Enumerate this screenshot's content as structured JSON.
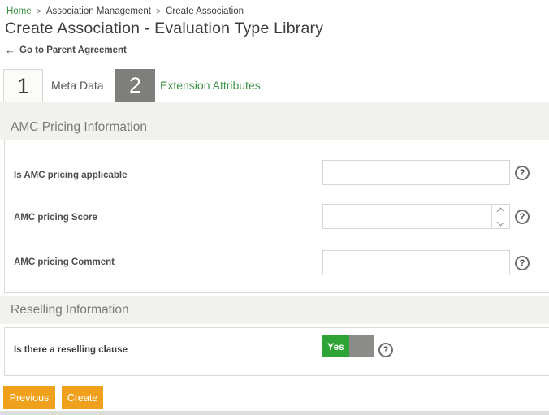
{
  "breadcrumb": {
    "separator": ">",
    "items": [
      "Home",
      "Association Management",
      "Create Association"
    ]
  },
  "page": {
    "title": "Create Association - Evaluation Type Library"
  },
  "parent_link": {
    "arrow": "←",
    "label": "Go to Parent Agreement"
  },
  "steps": [
    {
      "number": "1",
      "label": "Meta Data"
    },
    {
      "number": "2",
      "label": "Extension Attributes"
    }
  ],
  "sections": {
    "amc": {
      "title": "AMC Pricing Information",
      "fields": [
        {
          "label": "Is AMC pricing applicable",
          "value": ""
        },
        {
          "label": "AMC pricing Score",
          "value": ""
        },
        {
          "label": "AMC pricing Comment",
          "value": ""
        }
      ]
    },
    "reselling": {
      "title": "Reselling Information",
      "toggle_field": {
        "label": "Is there a reselling clause",
        "value": "Yes"
      }
    }
  },
  "buttons": {
    "previous": "Previous",
    "create": "Create"
  },
  "icons": {
    "help": "?"
  },
  "colors": {
    "accent_green": "#3c9245",
    "toggle_green": "#2ea336",
    "button_orange": "#efa11d",
    "step_inactive_gray": "#7e7e7b",
    "band_gray": "#f1f1ee"
  }
}
